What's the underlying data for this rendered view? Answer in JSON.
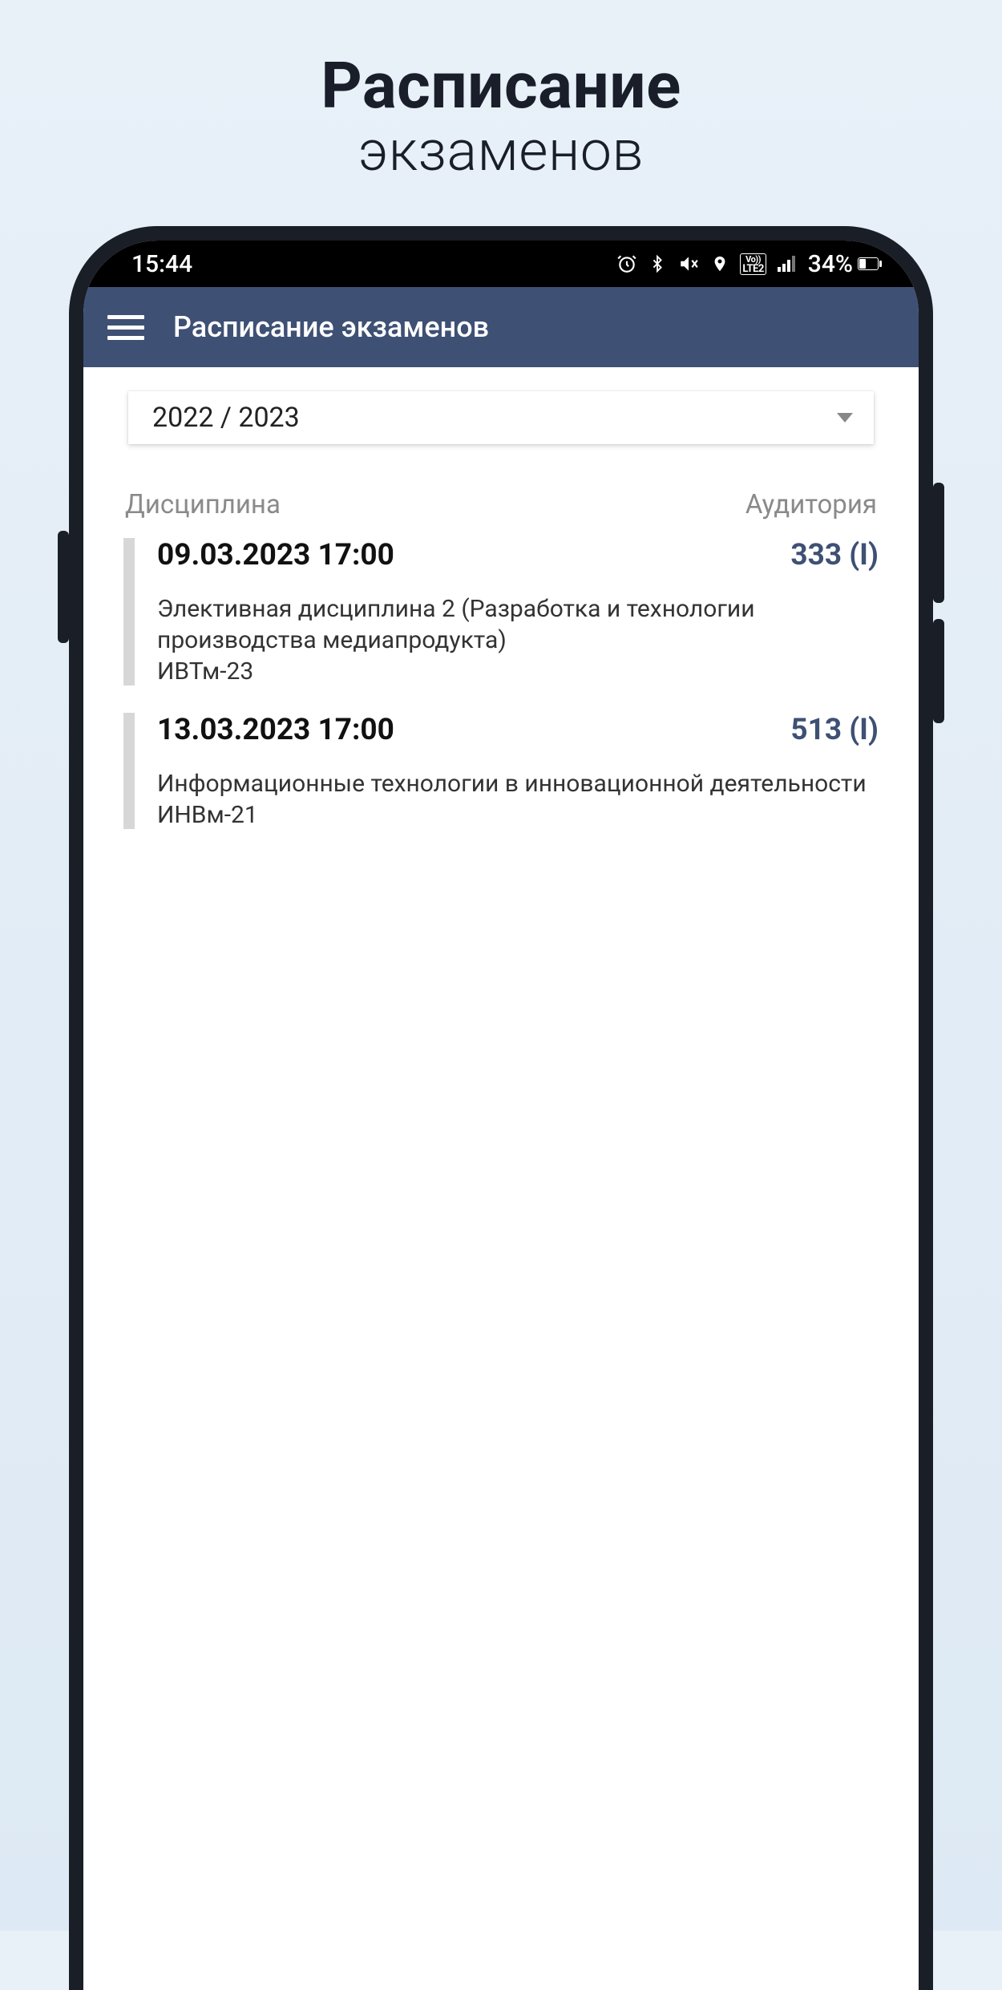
{
  "promo": {
    "line1": "Расписание",
    "line2": "экзаменов"
  },
  "status_bar": {
    "time": "15:44",
    "network_label_top": "Vo))",
    "network_label_bottom": "LTE2",
    "battery_text": "34%"
  },
  "app_bar": {
    "title": "Расписание экзаменов"
  },
  "year_selector": {
    "value": "2022 / 2023"
  },
  "headers": {
    "discipline": "Дисциплина",
    "room": "Аудитория"
  },
  "exams": [
    {
      "datetime": "09.03.2023 17:00",
      "room": "333 (I)",
      "description": "Элективная дисциплина 2 (Разработка и технологии производства медиапродукта)",
      "group": "ИВТм-23"
    },
    {
      "datetime": "13.03.2023 17:00",
      "room": "513 (I)",
      "description": "Информационные технологии в инновационной деятельности",
      "group": "ИНВм-21"
    }
  ],
  "colors": {
    "app_bar_bg": "#3e5074",
    "accent_text": "#3e5074"
  }
}
